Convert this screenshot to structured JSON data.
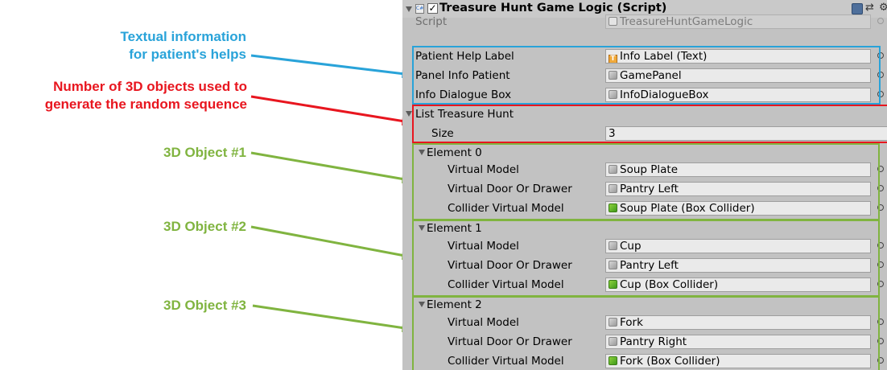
{
  "annotations": {
    "textual_info": [
      "Textual information",
      "for patient's helps"
    ],
    "num_objects": [
      "Number of 3D objects used to",
      "generate the random sequence"
    ],
    "object1": "3D Object #1",
    "object2": "3D Object #2",
    "object3": "3D Object #3",
    "colors": {
      "blue": "#29a3d9",
      "red": "#e8161f",
      "green": "#80b440"
    }
  },
  "component": {
    "title": "Treasure Hunt Game Logic (Script)",
    "enabled": true,
    "checkbox_glyph": "✓",
    "icons": {
      "help": "help-icon",
      "preset": "preset-icon",
      "settings": "gear-icon"
    },
    "preset_glyph": "⇄",
    "gear_glyph": "⚙",
    "script_icon_text": "C#"
  },
  "fields": {
    "script": {
      "label": "Script",
      "value": "TreasureHuntGameLogic"
    },
    "patient_help_label": {
      "label": "Patient Help Label",
      "value": "Info Label (Text)",
      "icon_text": "T"
    },
    "panel_info_patient": {
      "label": "Panel Info Patient",
      "value": "GamePanel"
    },
    "info_dialogue_box": {
      "label": "Info Dialogue Box",
      "value": "InfoDialogueBox"
    }
  },
  "list": {
    "label": "List Treasure Hunt",
    "size_label": "Size",
    "size_value": "3",
    "elements": [
      {
        "label": "Element 0",
        "virtual_model_label": "Virtual Model",
        "virtual_model": "Soup Plate",
        "door_label": "Virtual Door Or Drawer",
        "door": "Pantry Left",
        "collider_label": "Collider Virtual Model",
        "collider": "Soup Plate (Box Collider)"
      },
      {
        "label": "Element 1",
        "virtual_model_label": "Virtual Model",
        "virtual_model": "Cup",
        "door_label": "Virtual Door Or Drawer",
        "door": "Pantry Left",
        "collider_label": "Collider Virtual Model",
        "collider": "Cup (Box Collider)"
      },
      {
        "label": "Element 2",
        "virtual_model_label": "Virtual Model",
        "virtual_model": "Fork",
        "door_label": "Virtual Door Or Drawer",
        "door": "Pantry Right",
        "collider_label": "Collider Virtual Model",
        "collider": "Fork (Box Collider)"
      }
    ]
  }
}
